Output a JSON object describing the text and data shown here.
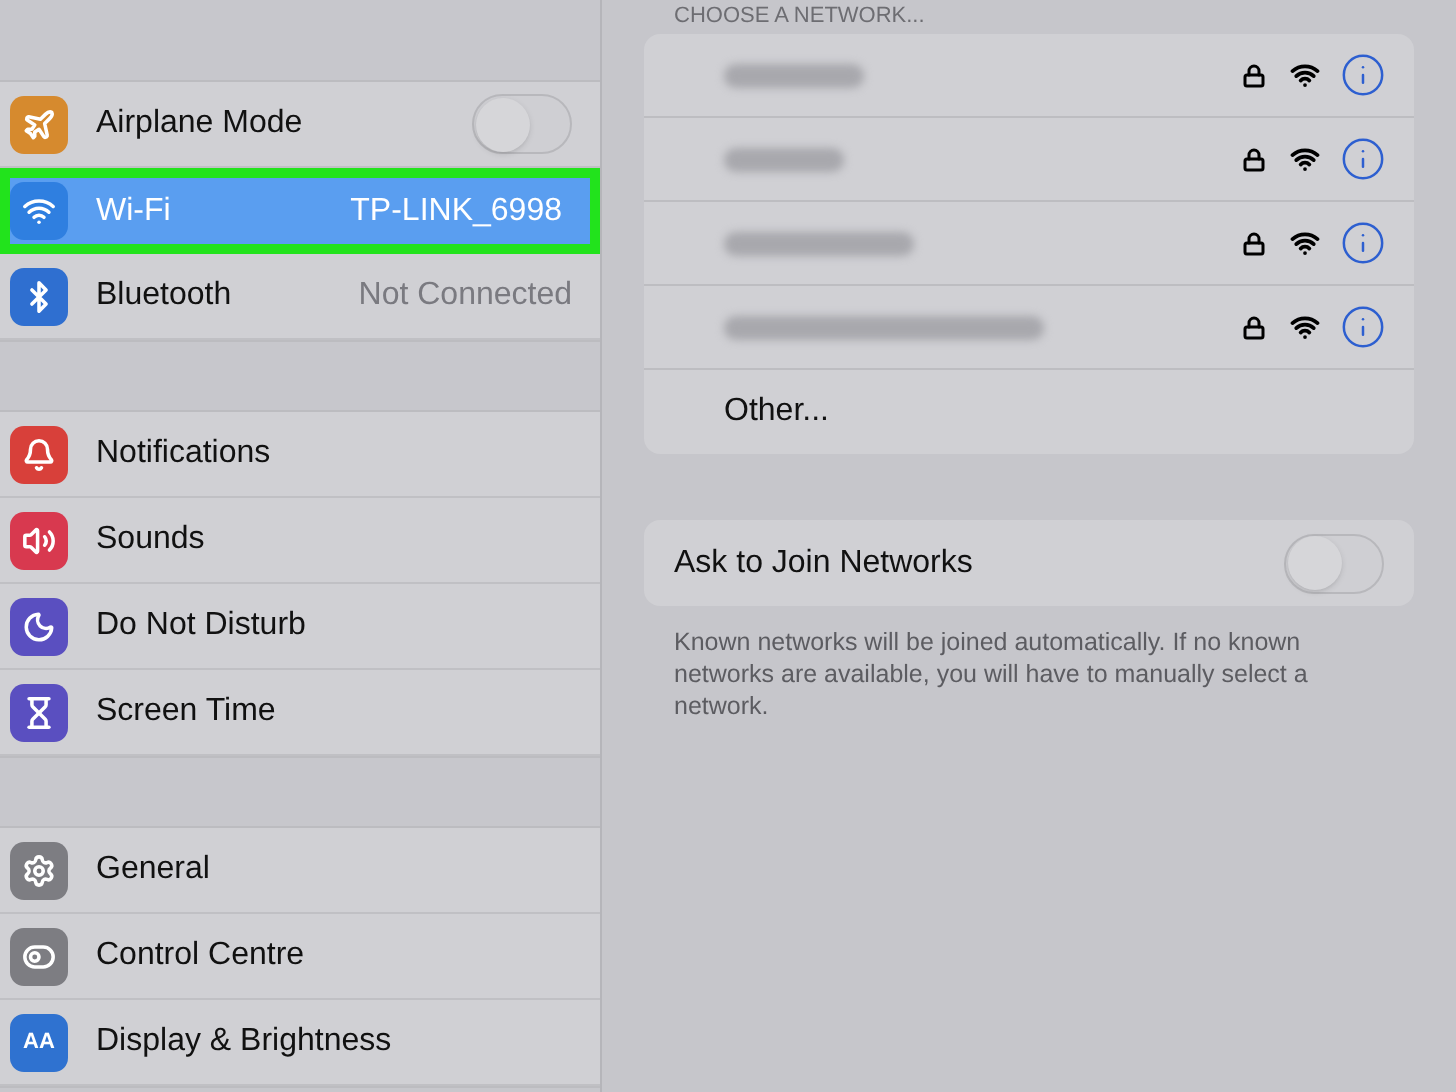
{
  "sidebar": {
    "groups": [
      {
        "items": [
          {
            "label": "Airplane Mode",
            "kind": "toggle",
            "on": false,
            "selected": false,
            "color": "#d68a2e"
          },
          {
            "label": "Wi-Fi",
            "kind": "value",
            "value": "TP-LINK_6998",
            "selected": true,
            "color": "#2f7fe0"
          },
          {
            "label": "Bluetooth",
            "kind": "value",
            "value": "Not Connected",
            "selected": false,
            "color": "#2f6fd0"
          }
        ]
      },
      {
        "items": [
          {
            "label": "Notifications",
            "kind": "link",
            "selected": false,
            "color": "#d8403a"
          },
          {
            "label": "Sounds",
            "kind": "link",
            "selected": false,
            "color": "#d8394f"
          },
          {
            "label": "Do Not Disturb",
            "kind": "link",
            "selected": false,
            "color": "#5a4fc0"
          },
          {
            "label": "Screen Time",
            "kind": "link",
            "selected": false,
            "color": "#5a4fc0"
          }
        ]
      },
      {
        "items": [
          {
            "label": "General",
            "kind": "link",
            "selected": false,
            "color": "#7d7d82"
          },
          {
            "label": "Control Centre",
            "kind": "link",
            "selected": false,
            "color": "#7d7d82"
          },
          {
            "label": "Display & Brightness",
            "kind": "link",
            "selected": false,
            "color": "#2f72d0",
            "icon_text": "AA"
          }
        ]
      }
    ]
  },
  "networks": {
    "header": "CHOOSE A NETWORK...",
    "items": [
      {
        "locked": true
      },
      {
        "locked": true
      },
      {
        "locked": true
      },
      {
        "locked": true
      }
    ],
    "other": "Other..."
  },
  "ask_to_join": {
    "label": "Ask to Join Networks",
    "on": false,
    "note": "Known networks will be joined automatically. If no known networks are available, you will have to manually select a network."
  }
}
